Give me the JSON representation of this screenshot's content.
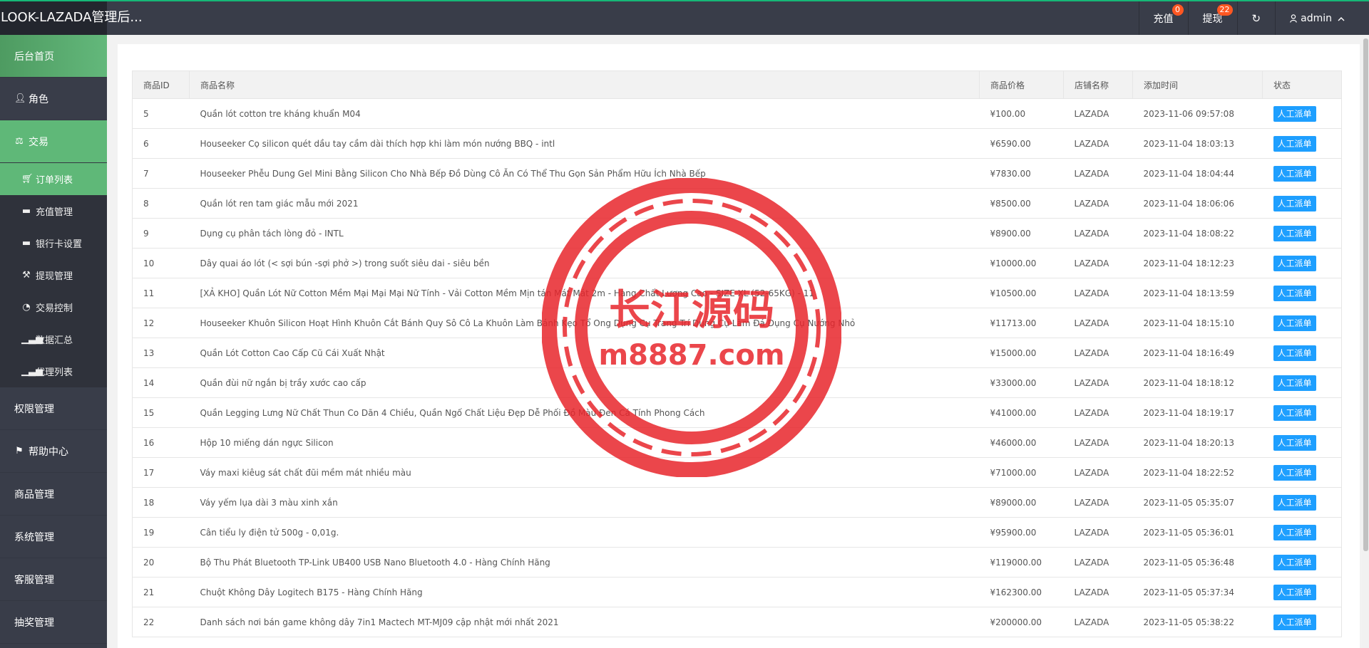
{
  "header": {
    "brand": "LOOK-LAZADA管理后...",
    "recharge_label": "充值",
    "recharge_badge": "0",
    "withdraw_label": "提现",
    "withdraw_badge": "22",
    "refresh_icon": "refresh-icon",
    "user_label": "admin",
    "accent_color": "#16b777"
  },
  "sidebar": {
    "items": [
      {
        "label": "后台首页"
      },
      {
        "label": "角色"
      },
      {
        "label": "交易"
      },
      {
        "label": "订单列表"
      },
      {
        "label": "充值管理"
      },
      {
        "label": "银行卡设置"
      },
      {
        "label": "提现管理"
      },
      {
        "label": "交易控制"
      },
      {
        "label": "数据汇总"
      },
      {
        "label": "代理列表"
      },
      {
        "label": "权限管理"
      },
      {
        "label": "帮助中心"
      },
      {
        "label": "商品管理"
      },
      {
        "label": "系统管理"
      },
      {
        "label": "客服管理"
      },
      {
        "label": "抽奖管理"
      }
    ]
  },
  "table": {
    "headers": [
      "商品ID",
      "商品名称",
      "商品价格",
      "店铺名称",
      "添加时间",
      "状态"
    ],
    "action_label": "人工派单",
    "rows": [
      [
        "5",
        "Quần lót cotton tre kháng khuẩn M04",
        "¥100.00",
        "LAZADA",
        "2023-11-06 09:57:08"
      ],
      [
        "6",
        "Houseeker Cọ silicon quét dầu tay cầm dài thích hợp khi làm món nướng BBQ - intl",
        "¥6590.00",
        "LAZADA",
        "2023-11-04 18:03:13"
      ],
      [
        "7",
        "Houseeker Phễu Dung Gel Mini Bằng Silicon Cho Nhà Bếp Đồ Dùng Cô Ăn Có Thể Thu Gọn Sản Phẩm Hữu Ích Nhà Bếp",
        "¥7830.00",
        "LAZADA",
        "2023-11-04 18:04:44"
      ],
      [
        "8",
        "Quần lót ren tam giác mẫu mới 2021",
        "¥8500.00",
        "LAZADA",
        "2023-11-04 18:06:06"
      ],
      [
        "9",
        "Dụng cụ phân tách lòng đỏ - INTL",
        "¥8900.00",
        "LAZADA",
        "2023-11-04 18:08:22"
      ],
      [
        "10",
        "Dây quai áo lót (< sợi bún -sợi phở >) trong suốt siêu dai - siêu bền",
        "¥10000.00",
        "LAZADA",
        "2023-11-04 18:12:23"
      ],
      [
        "11",
        "[XẢ KHO] Quần Lót Nữ Cotton Mềm Mại Mại Mại Nữ Tính - Vải Cotton Mềm Mịn tán Mát Mát 2m - Hàng Chất Lượng Cao - SIZE XL (52-65KG) - 11",
        "¥10500.00",
        "LAZADA",
        "2023-11-04 18:13:59"
      ],
      [
        "12",
        "Houseeker Khuôn Silicon Hoạt Hình Khuôn Cắt Bánh Quy Sô Cô La Khuôn Làm Bánh Kẹo Tổ Ong Dụng Cụ Trang Trí Dụng Cụ Làm Đá Dụng Cụ Nướng Nhỏ",
        "¥11713.00",
        "LAZADA",
        "2023-11-04 18:15:10"
      ],
      [
        "13",
        "Quần Lót Cotton Cao Cấp Cũ Cái Xuất Nhật",
        "¥15000.00",
        "LAZADA",
        "2023-11-04 18:16:49"
      ],
      [
        "14",
        "Quần đùi nữ ngắn bị trầy xước cao cấp",
        "¥33000.00",
        "LAZADA",
        "2023-11-04 18:18:12"
      ],
      [
        "15",
        "Quần Legging Lưng Nữ Chất Thun Co Dãn 4 Chiều, Quần Ngố Chất Liệu Đẹp Dễ Phối Đồ Màu Đen Cá Tính Phong Cách",
        "¥41000.00",
        "LAZADA",
        "2023-11-04 18:19:17"
      ],
      [
        "16",
        "Hộp 10 miếng dán ngực Silicon",
        "¥46000.00",
        "LAZADA",
        "2023-11-04 18:20:13"
      ],
      [
        "17",
        "Váy maxi kiêug sát chất đũi mềm mát nhiều màu",
        "¥71000.00",
        "LAZADA",
        "2023-11-04 18:22:52"
      ],
      [
        "18",
        "Váy yếm lụa dài 3 màu xinh xắn",
        "¥89000.00",
        "LAZADA",
        "2023-11-05 05:35:07"
      ],
      [
        "19",
        "Cân tiểu ly điện tử 500g - 0,01g.",
        "¥95900.00",
        "LAZADA",
        "2023-11-05 05:36:01"
      ],
      [
        "20",
        "Bộ Thu Phát Bluetooth TP-Link UB400 USB Nano Bluetooth 4.0 - Hàng Chính Hãng",
        "¥119000.00",
        "LAZADA",
        "2023-11-05 05:36:48"
      ],
      [
        "21",
        "Chuột Không Dây Logitech B175 - Hàng Chính Hãng",
        "¥162300.00",
        "LAZADA",
        "2023-11-05 05:37:34"
      ],
      [
        "22",
        "Danh sách nơi bán game không dây 7in1 Mactech MT-MJ09 cập nhật mới nhất 2021",
        "¥200000.00",
        "LAZADA",
        "2023-11-05 05:38:22"
      ]
    ]
  },
  "watermark": {
    "line1": "长江源码",
    "line2": "m8887.com",
    "color": "#e8262c"
  }
}
